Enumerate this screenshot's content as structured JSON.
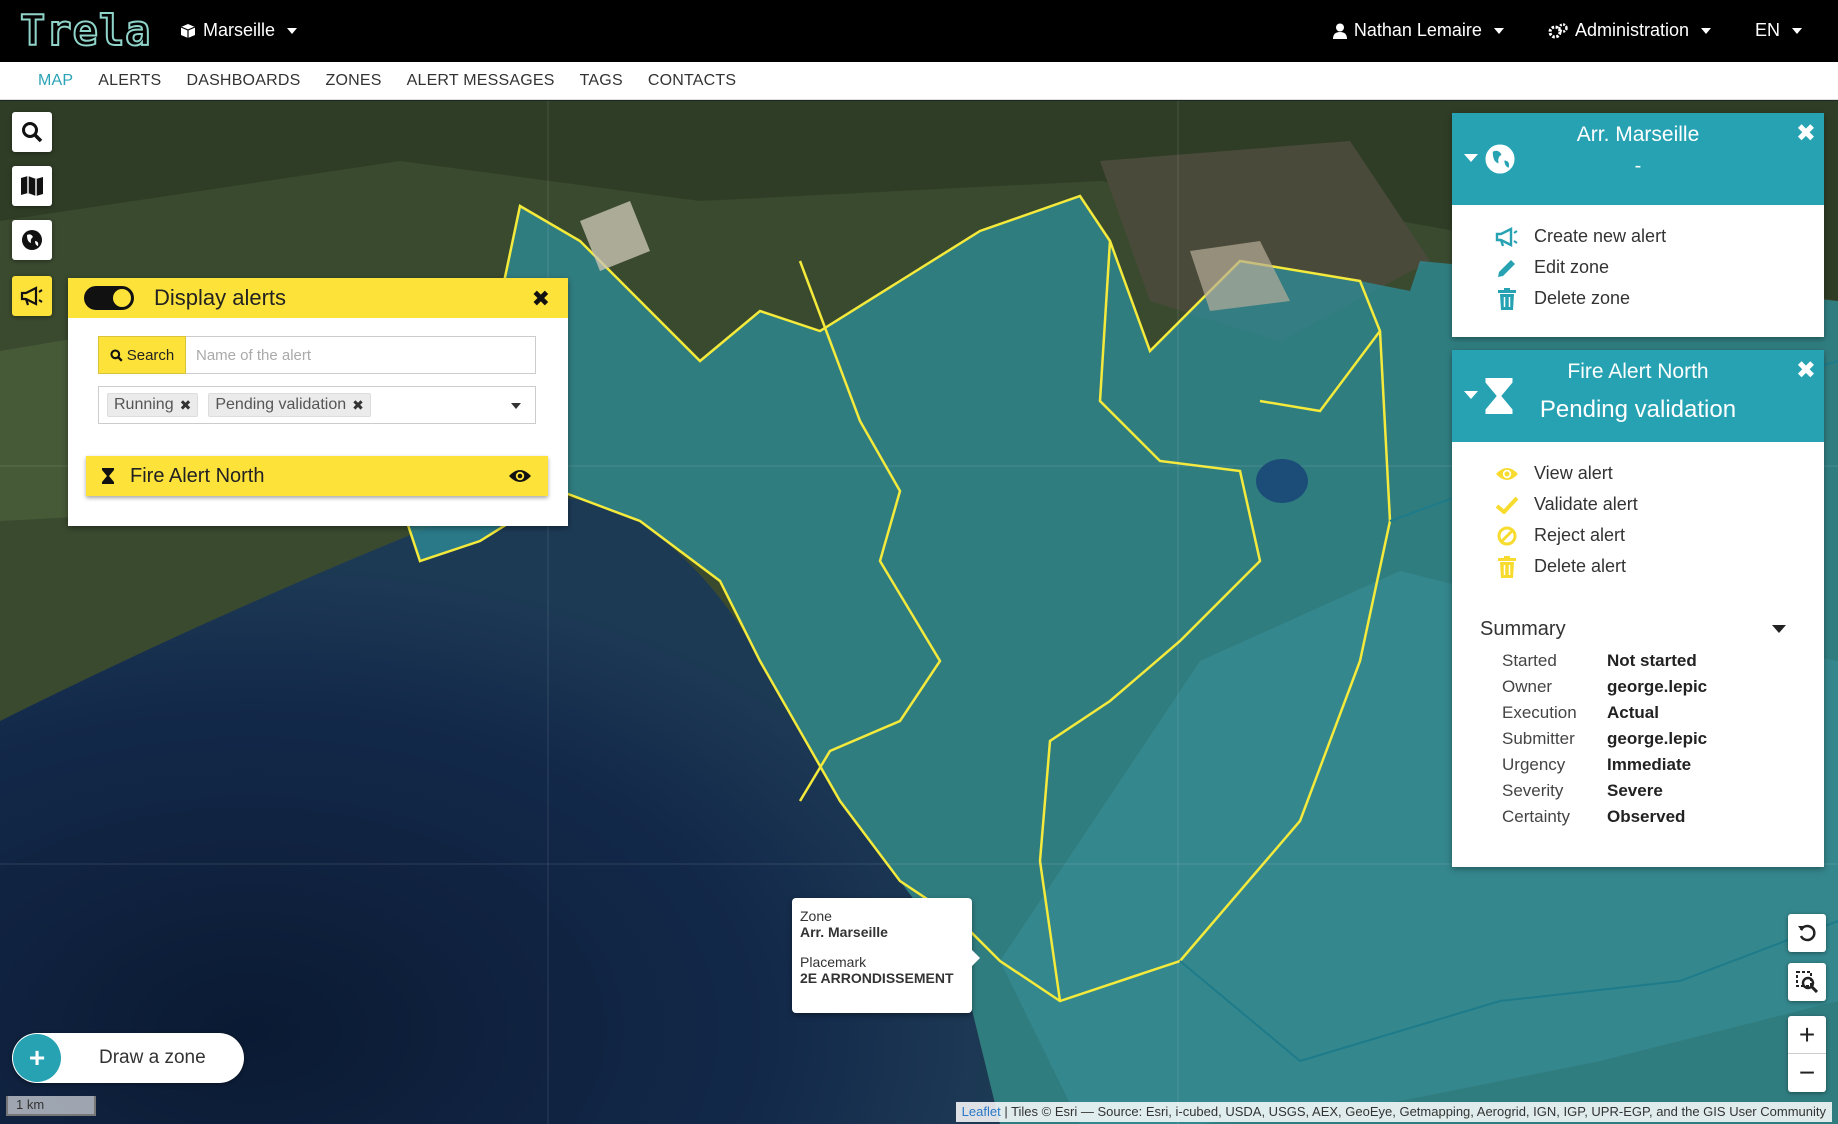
{
  "header": {
    "logo": "Trela",
    "city": "Marseille",
    "user": "Nathan Lemaire",
    "admin": "Administration",
    "lang": "EN"
  },
  "nav": [
    "MAP",
    "ALERTS",
    "DASHBOARDS",
    "ZONES",
    "ALERT MESSAGES",
    "TAGS",
    "CONTACTS"
  ],
  "alerts_panel": {
    "title": "Display alerts",
    "search_label": "Search",
    "search_placeholder": "Name of the alert",
    "filters": [
      "Running",
      "Pending validation"
    ],
    "items": [
      {
        "name": "Fire Alert North"
      }
    ]
  },
  "zone_panel": {
    "title": "Arr. Marseille",
    "subtitle": "-",
    "actions": [
      "Create new alert",
      "Edit zone",
      "Delete zone"
    ]
  },
  "alert_panel": {
    "title": "Fire Alert North",
    "status": "Pending validation",
    "actions": [
      "View alert",
      "Validate alert",
      "Reject alert",
      "Delete alert"
    ],
    "summary_title": "Summary",
    "summary": [
      {
        "k": "Started",
        "v": "Not started"
      },
      {
        "k": "Owner",
        "v": "george.lepic"
      },
      {
        "k": "Execution",
        "v": "Actual"
      },
      {
        "k": "Submitter",
        "v": "george.lepic"
      },
      {
        "k": "Urgency",
        "v": "Immediate"
      },
      {
        "k": "Severity",
        "v": "Severe"
      },
      {
        "k": "Certainty",
        "v": "Observed"
      }
    ]
  },
  "popup": {
    "zone_label": "Zone",
    "zone_value": "Arr. Marseille",
    "placemark_label": "Placemark",
    "placemark_value": "2E ARRONDISSEMENT"
  },
  "draw_zone": "Draw a zone",
  "scale": "1 km",
  "attribution": {
    "leaflet": "Leaflet",
    "text": " | Tiles © Esri — Source: Esri, i-cubed, USDA, USGS, AEX, GeoEye, Getmapping, Aerogrid, IGN, IGP, UPR-EGP, and the GIS User Community"
  },
  "colors": {
    "accent": "#26a2b3",
    "yellow": "#fde23a",
    "nav_active": "#2aa3b6"
  }
}
